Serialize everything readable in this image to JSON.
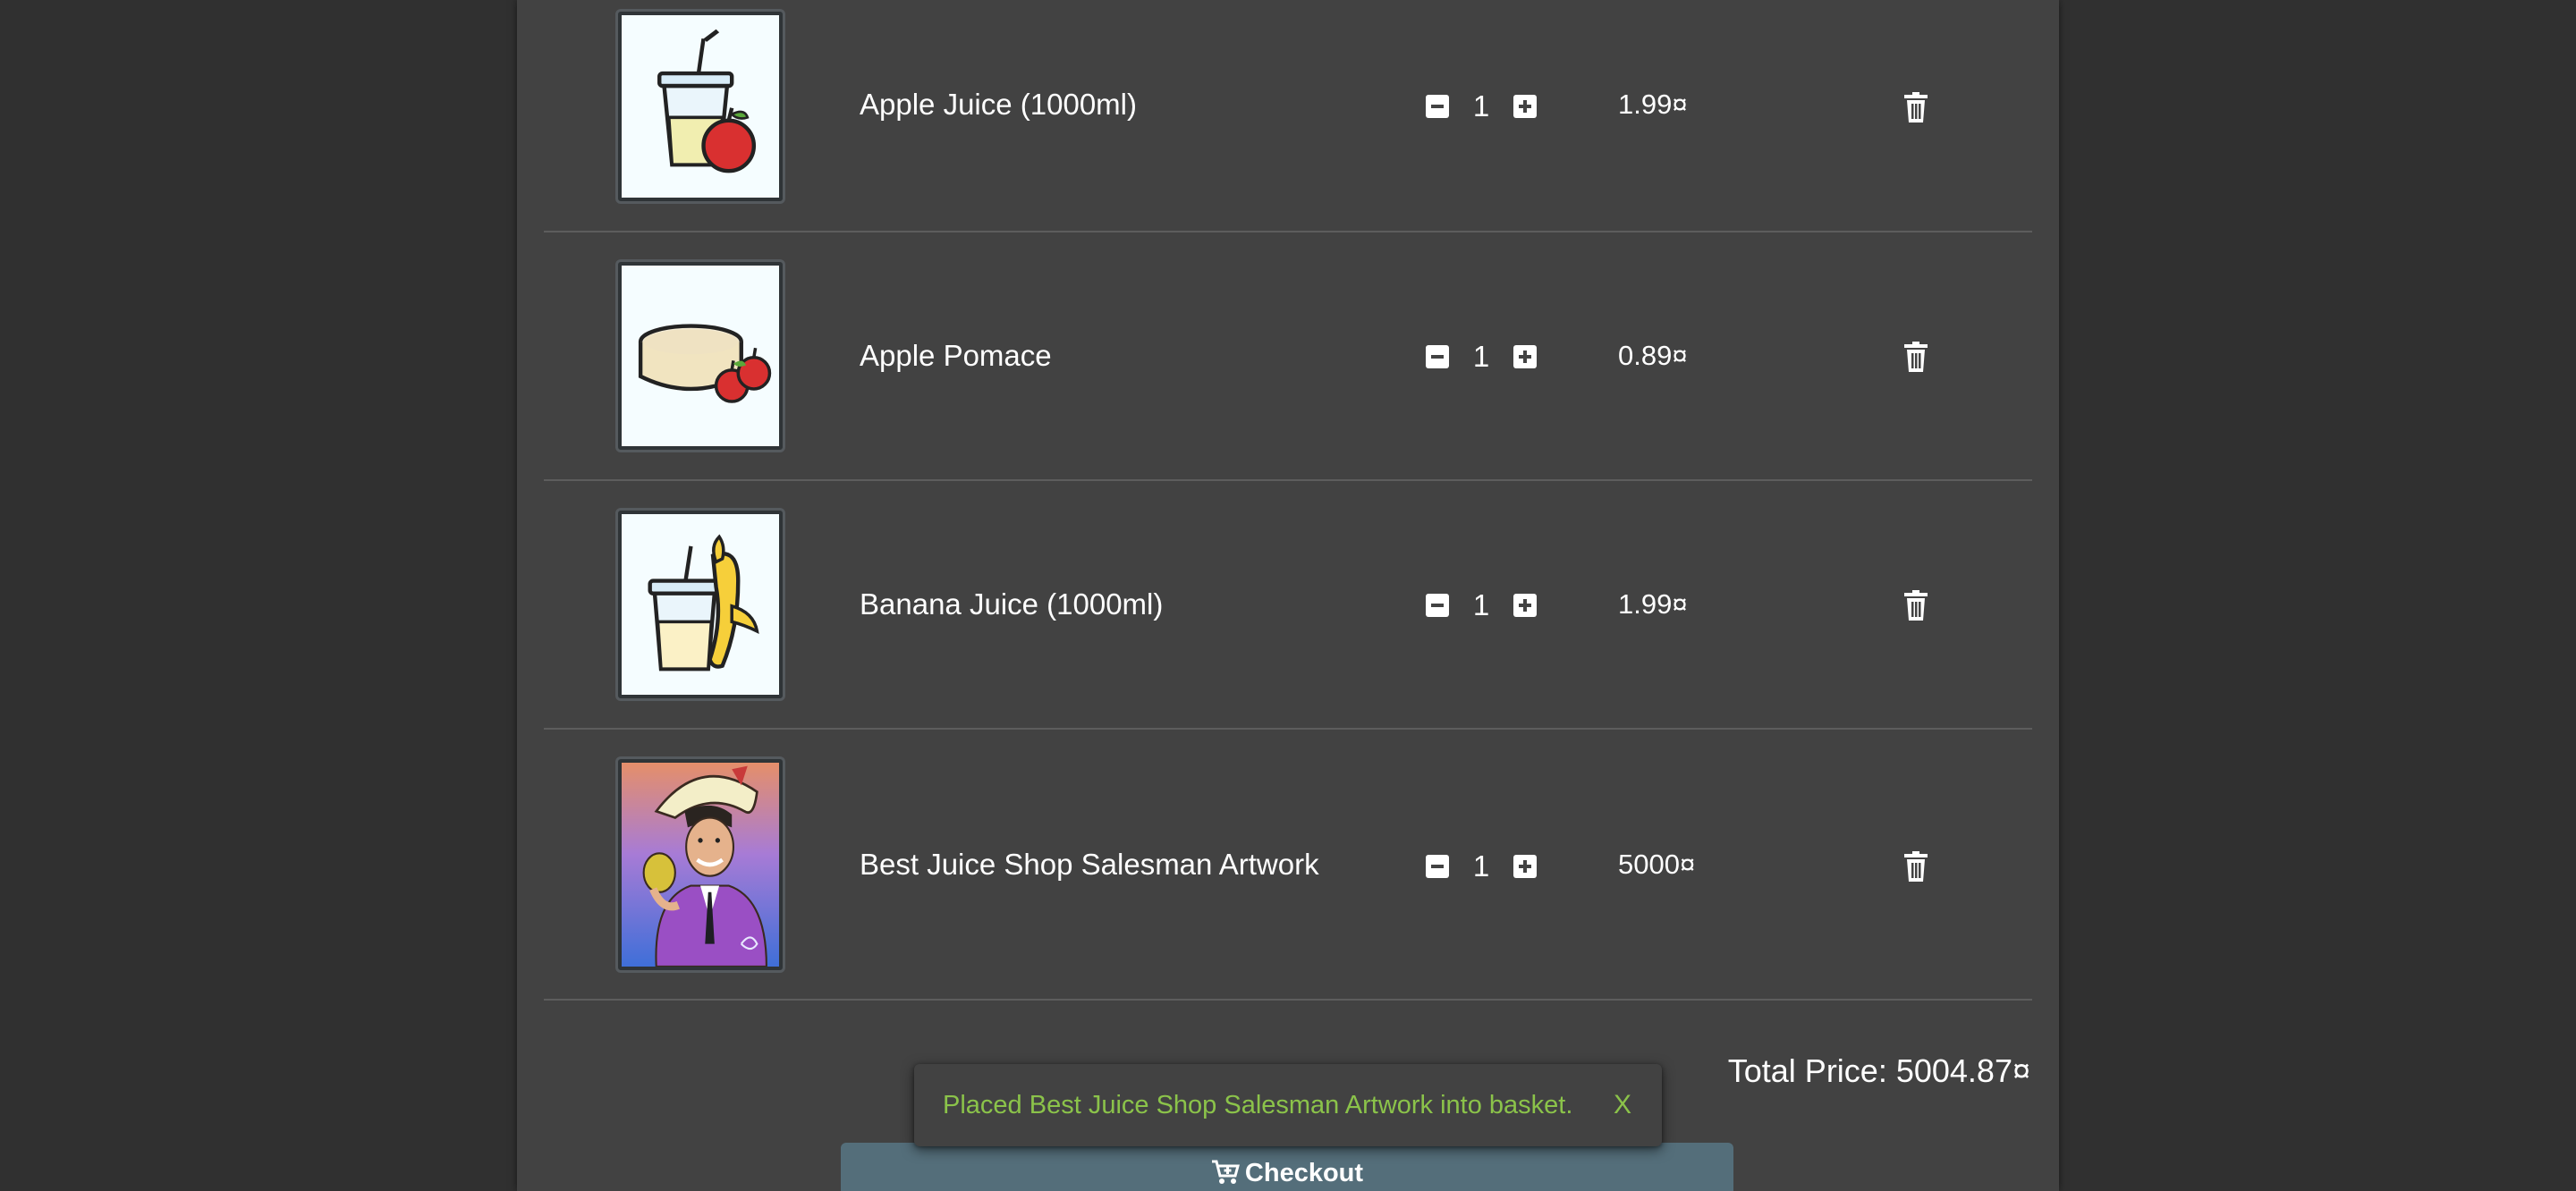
{
  "basket": {
    "items": [
      {
        "name": "Apple Juice (1000ml)",
        "quantity": "1",
        "price": "1.99¤",
        "image": "apple-juice-image"
      },
      {
        "name": "Apple Pomace",
        "quantity": "1",
        "price": "0.89¤",
        "image": "apple-pomace-image"
      },
      {
        "name": "Banana Juice (1000ml)",
        "quantity": "1",
        "price": "1.99¤",
        "image": "banana-juice-image"
      },
      {
        "name": "Best Juice Shop Salesman Artwork",
        "quantity": "1",
        "price": "5000¤",
        "image": "salesman-artwork-image"
      }
    ],
    "total_price": "Total Price: 5004.87¤",
    "checkout_label": "Checkout"
  },
  "snackbar": {
    "message": "Placed Best Juice Shop Salesman Artwork into basket.",
    "close_label": "X"
  },
  "colors": {
    "background": "#303030",
    "card": "#424242",
    "checkout_button": "#546e7a",
    "snackbar_text": "#8bc34a"
  }
}
